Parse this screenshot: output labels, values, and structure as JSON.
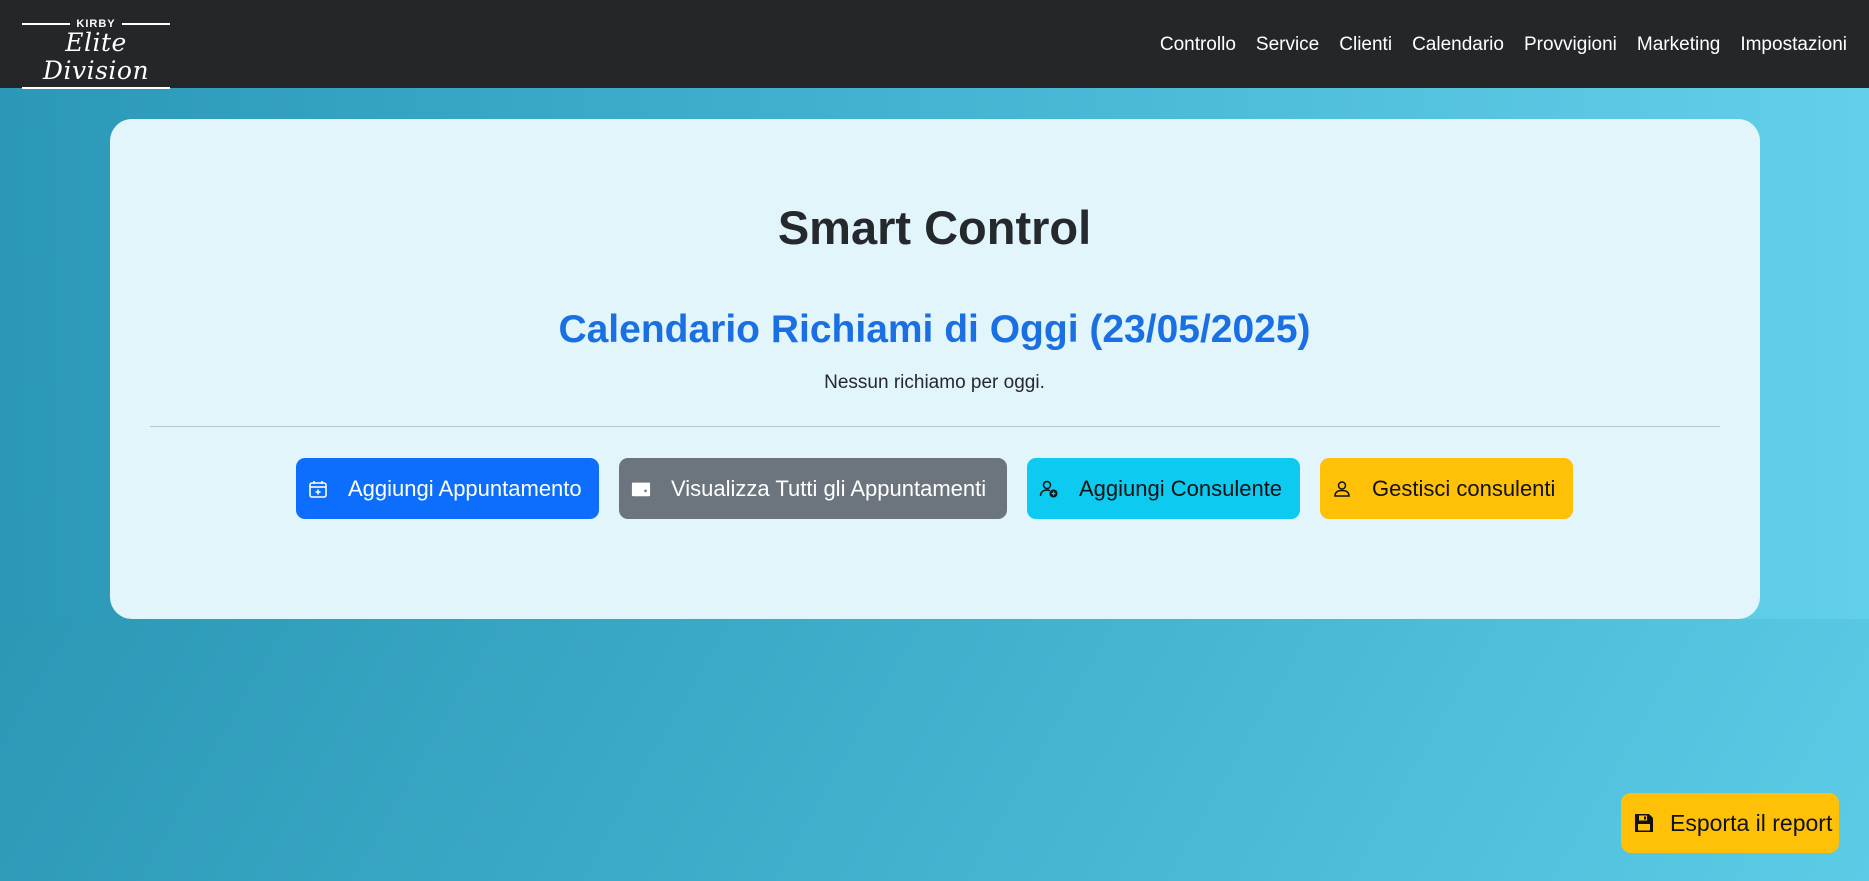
{
  "brand": {
    "top_text": "KIRBY",
    "script_text": "Elite Division"
  },
  "nav": {
    "items": [
      {
        "label": "Controllo"
      },
      {
        "label": "Service"
      },
      {
        "label": "Clienti"
      },
      {
        "label": "Calendario"
      },
      {
        "label": "Provvigioni"
      },
      {
        "label": "Marketing"
      },
      {
        "label": "Impostazioni"
      }
    ]
  },
  "main": {
    "title": "Smart Control",
    "subtitle": "Calendario Richiami di Oggi (23/05/2025)",
    "empty_message": "Nessun richiamo per oggi."
  },
  "actions": {
    "add_appointment": {
      "label": "Aggiungi Appuntamento",
      "icon": "calendar-plus-icon",
      "color": "#0d6efd"
    },
    "view_appointments": {
      "label": "Visualizza Tutti gli Appuntamenti",
      "icon": "wallet-icon",
      "color": "#6c757d"
    },
    "add_consultant": {
      "label": "Aggiungi Consulente",
      "icon": "person-add-icon",
      "color": "#0dcaf0"
    },
    "manage_consultants": {
      "label": "Gestisci consulenti",
      "icon": "person-icon",
      "color": "#ffc107"
    }
  },
  "export": {
    "label": "Esporta il report",
    "icon": "save-icon",
    "color": "#ffc107"
  },
  "colors": {
    "navbar": "#242628",
    "card": "#e2f5fb",
    "subtitle": "#1a6fe3"
  }
}
